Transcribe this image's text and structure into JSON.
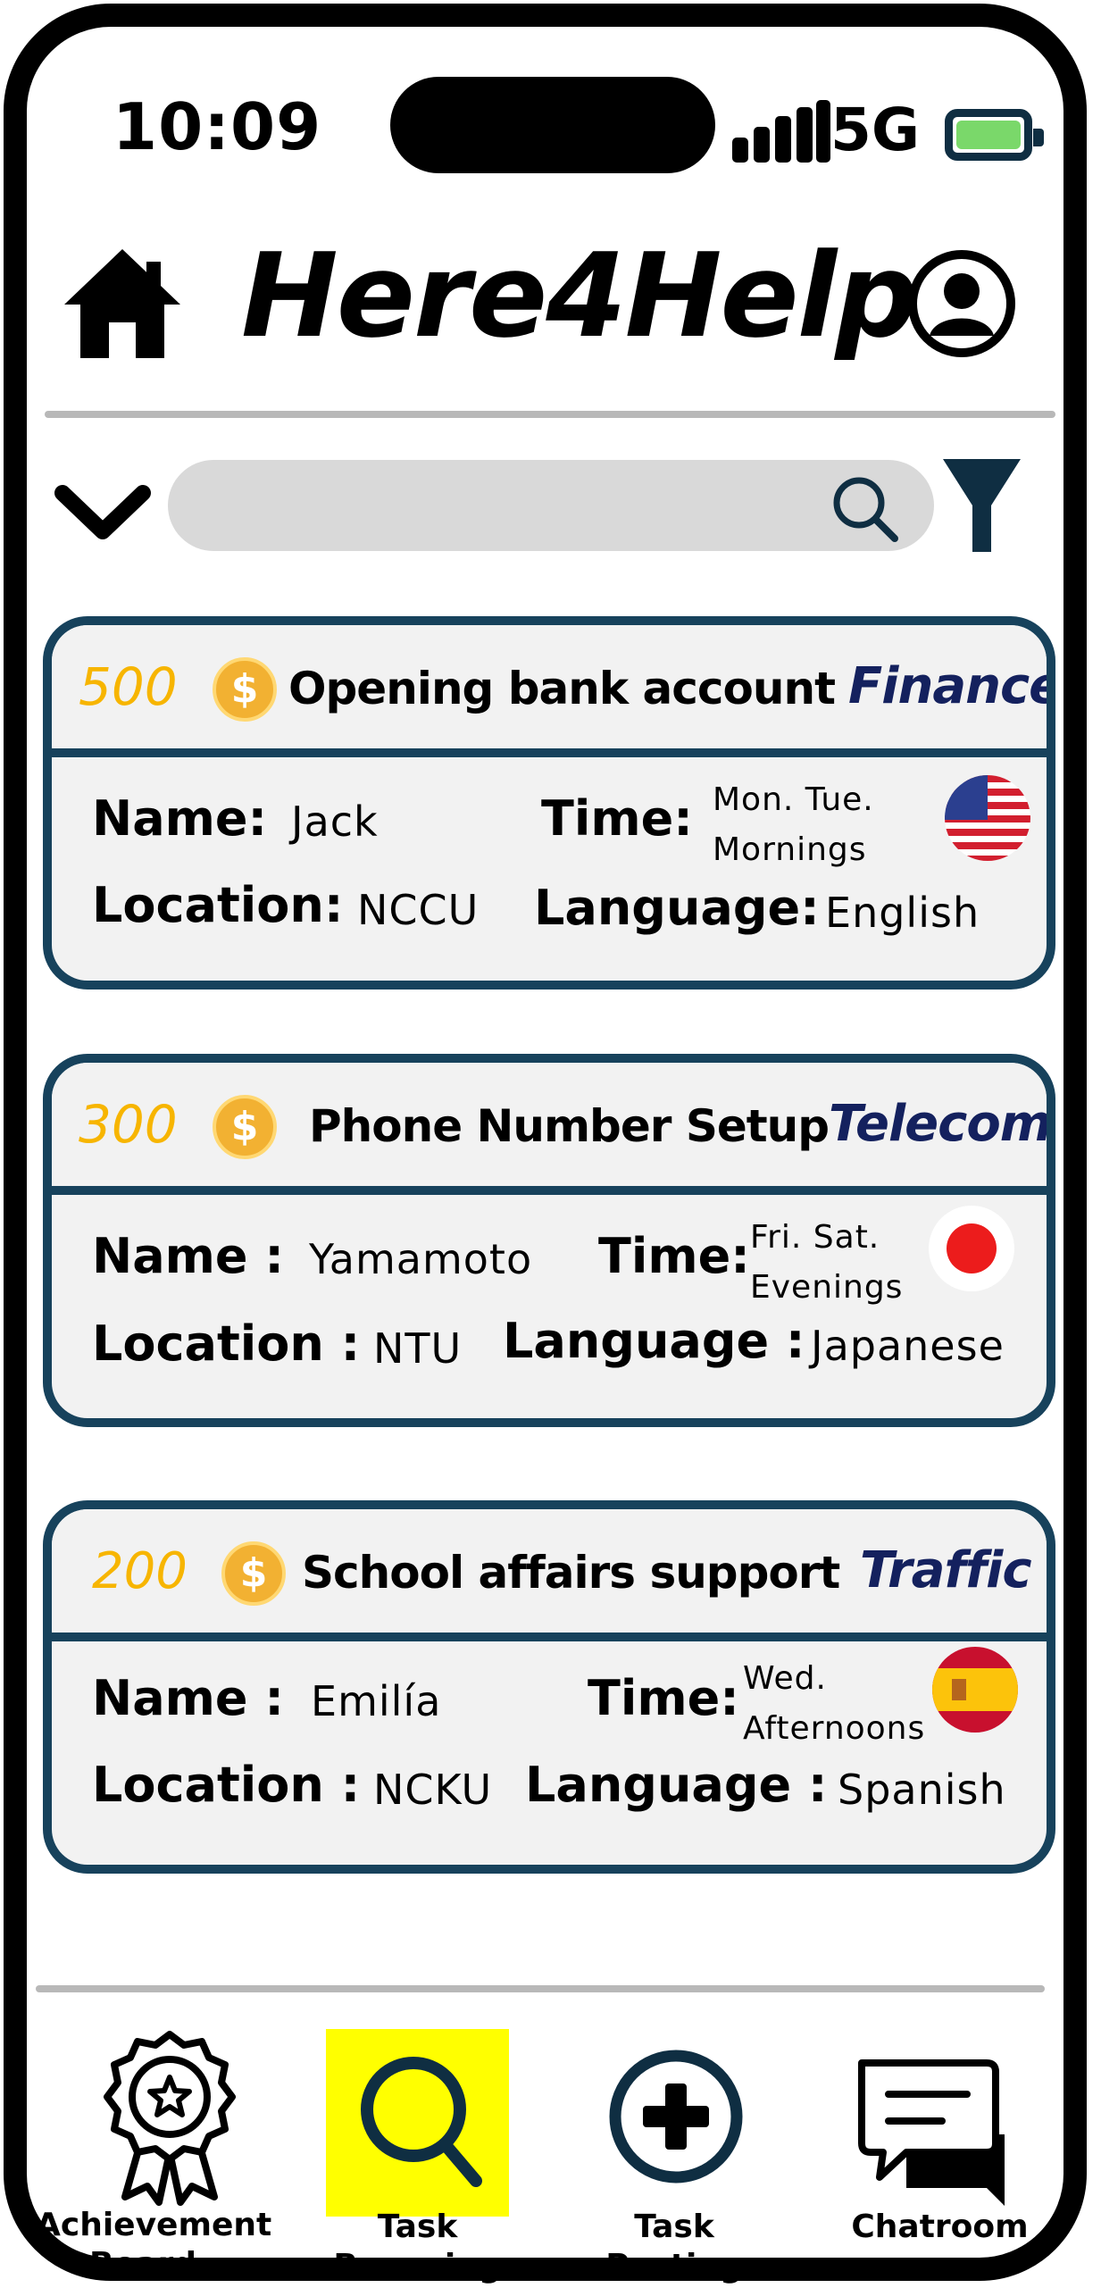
{
  "status_bar": {
    "time": "10:09",
    "network": "5G"
  },
  "header": {
    "app_title": "Here4Help",
    "home_icon": "home-icon",
    "profile_icon": "user-circle-icon"
  },
  "search": {
    "placeholder": "",
    "expand_icon": "chevron-down-icon",
    "search_icon": "search-icon",
    "filter_icon": "filter-icon"
  },
  "tasks": [
    {
      "points": "500",
      "title": "Opening bank account",
      "category": "Finance",
      "name_label": "Name:",
      "name": "Jack",
      "time_label": "Time:",
      "time": "Mon. Tue.\nMornings",
      "location_label": "Location:",
      "location": "NCCU",
      "language_label": "Language:",
      "language": "English",
      "flag": "us-flag"
    },
    {
      "points": "300",
      "title": "Phone Number Setup",
      "category": "Telecom",
      "name_label": "Name :",
      "name": "Yamamoto",
      "time_label": "Time:",
      "time": "Fri. Sat.\nEvenings",
      "location_label": "Location :",
      "location": "NTU",
      "language_label": "Language :",
      "language": "Japanese",
      "flag": "japan-flag"
    },
    {
      "points": "200",
      "title": "School affairs support",
      "category": "Traffic",
      "name_label": "Name :",
      "name": "Emilía",
      "time_label": "Time:",
      "time": "Wed.\nAfternoons",
      "location_label": "Location :",
      "location": "NCKU",
      "language_label": "Language :",
      "language": "Spanish",
      "flag": "spain-flag"
    }
  ],
  "bottom_nav": [
    {
      "label": "Achievement\nBoard",
      "icon": "award-badge-icon",
      "active": false
    },
    {
      "label": "Task\nBrowsing",
      "icon": "search-icon",
      "active": true
    },
    {
      "label": "Task\nPosting",
      "icon": "plus-circle-icon",
      "active": false
    },
    {
      "label": "Chatroom",
      "icon": "chat-icon",
      "active": false
    }
  ],
  "colors": {
    "card_border": "#17425c",
    "points": "#f7b500",
    "category": "#14215e",
    "active_tab": "#ffff00",
    "battery": "#7ad86a"
  }
}
